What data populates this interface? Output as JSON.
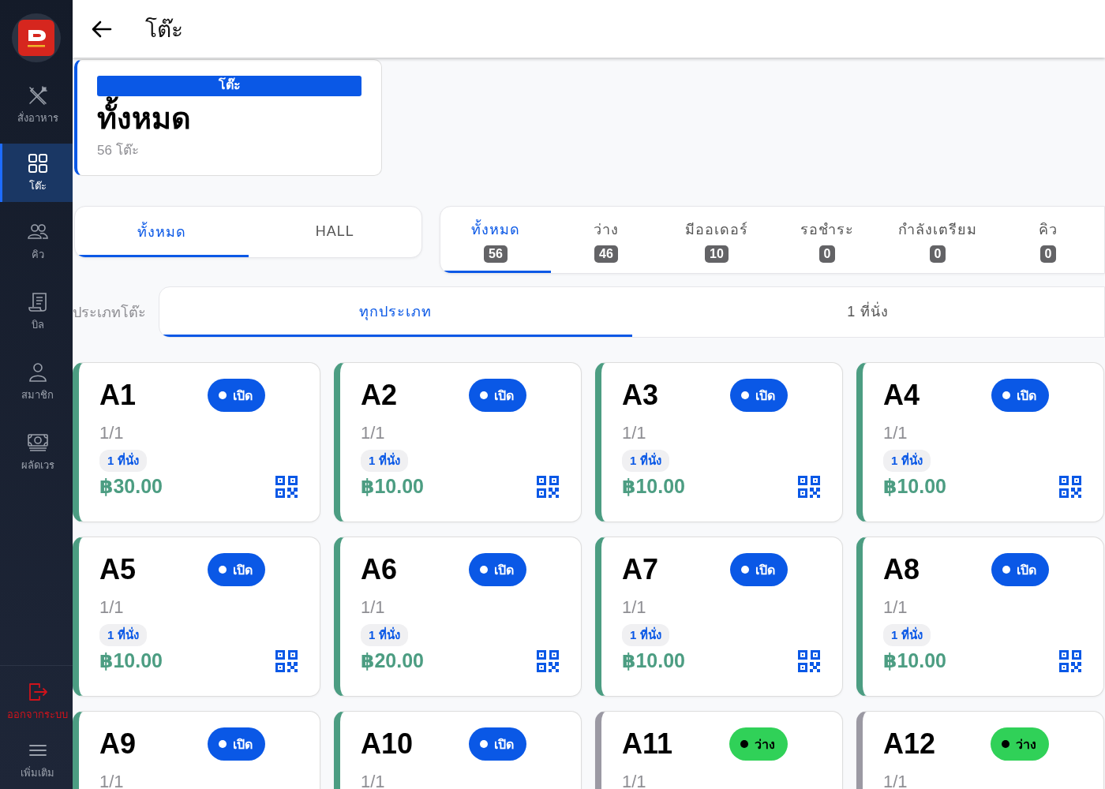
{
  "sidebar": {
    "items": [
      {
        "kind": "order",
        "label": "สั่งอาหาร",
        "selected": false
      },
      {
        "kind": "tables",
        "label": "โต๊ะ",
        "selected": true
      },
      {
        "kind": "queue",
        "label": "คิว",
        "selected": false
      },
      {
        "kind": "bill",
        "label": "บิล",
        "selected": false
      },
      {
        "kind": "member",
        "label": "สมาชิก",
        "selected": false
      },
      {
        "kind": "shift",
        "label": "ผลัดเวร",
        "selected": false
      }
    ],
    "bottom_items": [
      {
        "kind": "logout",
        "label": "ออกจากระบบ"
      },
      {
        "kind": "more",
        "label": "เพิ่มเติม"
      }
    ]
  },
  "header": {
    "title": "โต๊ะ"
  },
  "summary": {
    "tag": "โต๊ะ",
    "title": "ทั้งหมด",
    "subtitle": "56 โต๊ะ"
  },
  "zone_tabs": [
    {
      "label": "ทั้งหมด",
      "selected": true
    },
    {
      "label": "HALL",
      "selected": false
    }
  ],
  "status_tabs": [
    {
      "label": "ทั้งหมด",
      "count": "56",
      "selected": true
    },
    {
      "label": "ว่าง",
      "count": "46",
      "selected": false
    },
    {
      "label": "มีออเดอร์",
      "count": "10",
      "selected": false
    },
    {
      "label": "รอชำระ",
      "count": "0",
      "selected": false
    },
    {
      "label": "กำลังเตรียม",
      "count": "0",
      "selected": false
    },
    {
      "label": "คิว",
      "count": "0",
      "selected": false
    }
  ],
  "type_filter": {
    "label": "ประเภทโต๊ะ",
    "tabs": [
      {
        "label": "ทุกประเภท",
        "selected": true
      },
      {
        "label": "1 ที่นั่ง",
        "selected": false
      }
    ]
  },
  "tables": [
    {
      "name": "A1",
      "kind": "open",
      "status_label": "เปิด",
      "occupancy": "1/1",
      "seats": "1 ที่นั่ง",
      "amount": "฿30.00"
    },
    {
      "name": "A2",
      "kind": "open",
      "status_label": "เปิด",
      "occupancy": "1/1",
      "seats": "1 ที่นั่ง",
      "amount": "฿10.00"
    },
    {
      "name": "A3",
      "kind": "open",
      "status_label": "เปิด",
      "occupancy": "1/1",
      "seats": "1 ที่นั่ง",
      "amount": "฿10.00"
    },
    {
      "name": "A4",
      "kind": "open",
      "status_label": "เปิด",
      "occupancy": "1/1",
      "seats": "1 ที่นั่ง",
      "amount": "฿10.00"
    },
    {
      "name": "A5",
      "kind": "open",
      "status_label": "เปิด",
      "occupancy": "1/1",
      "seats": "1 ที่นั่ง",
      "amount": "฿10.00"
    },
    {
      "name": "A6",
      "kind": "open",
      "status_label": "เปิด",
      "occupancy": "1/1",
      "seats": "1 ที่นั่ง",
      "amount": "฿20.00"
    },
    {
      "name": "A7",
      "kind": "open",
      "status_label": "เปิด",
      "occupancy": "1/1",
      "seats": "1 ที่นั่ง",
      "amount": "฿10.00"
    },
    {
      "name": "A8",
      "kind": "open",
      "status_label": "เปิด",
      "occupancy": "1/1",
      "seats": "1 ที่นั่ง",
      "amount": "฿10.00"
    },
    {
      "name": "A9",
      "kind": "open",
      "status_label": "เปิด",
      "occupancy": "1/1"
    },
    {
      "name": "A10",
      "kind": "open",
      "status_label": "เปิด",
      "occupancy": "1/1"
    },
    {
      "name": "A11",
      "kind": "vacant",
      "status_label": "ว่าง",
      "occupancy": "1/1"
    },
    {
      "name": "A12",
      "kind": "vacant",
      "status_label": "ว่าง",
      "occupancy": "1/1"
    }
  ]
}
